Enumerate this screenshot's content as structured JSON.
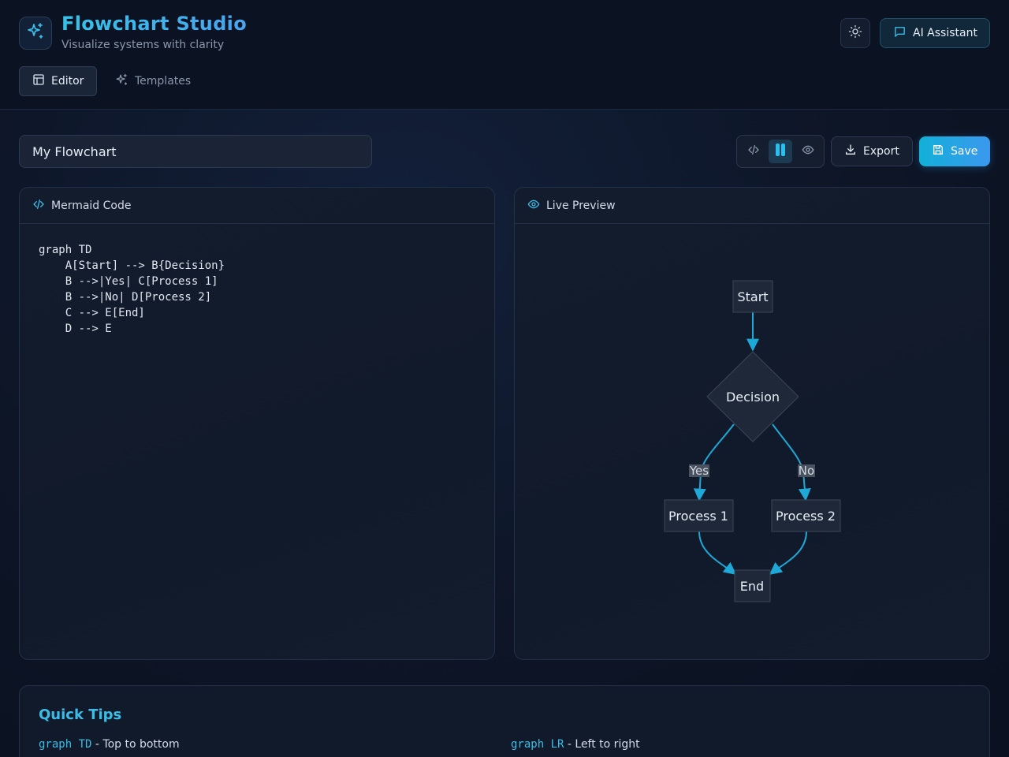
{
  "app": {
    "title": "Flowchart Studio",
    "subtitle": "Visualize systems with clarity"
  },
  "header": {
    "ai_label": "AI Assistant"
  },
  "nav": {
    "tabs": [
      {
        "label": "Editor",
        "icon": "layout-icon",
        "active": true
      },
      {
        "label": "Templates",
        "icon": "sparkles-icon",
        "active": false
      }
    ]
  },
  "toolbar": {
    "name_value": "My Flowchart",
    "view_modes": [
      "code",
      "split",
      "preview"
    ],
    "active_view": "split",
    "export_label": "Export",
    "save_label": "Save"
  },
  "editor": {
    "title": "Mermaid Code",
    "code": "graph TD\n    A[Start] --> B{Decision}\n    B -->|Yes| C[Process 1]\n    B -->|No| D[Process 2]\n    C --> E[End]\n    D --> E"
  },
  "preview": {
    "title": "Live Preview",
    "nodes": {
      "start": "Start",
      "decision": "Decision",
      "process1": "Process 1",
      "process2": "Process 2",
      "end": "End"
    },
    "edge_labels": {
      "yes": "Yes",
      "no": "No"
    }
  },
  "tips": {
    "title": "Quick Tips",
    "items": [
      {
        "code": "graph TD",
        "text": " - Top to bottom"
      },
      {
        "code": "graph LR",
        "text": " - Left to right"
      }
    ]
  },
  "colors": {
    "accent": "#3bbde8",
    "edge": "#1ea8d8",
    "node_fill": "#1e2838",
    "node_stroke": "#3a4658",
    "save_gradient_start": "#12b0d8",
    "save_gradient_end": "#3b98ee"
  }
}
